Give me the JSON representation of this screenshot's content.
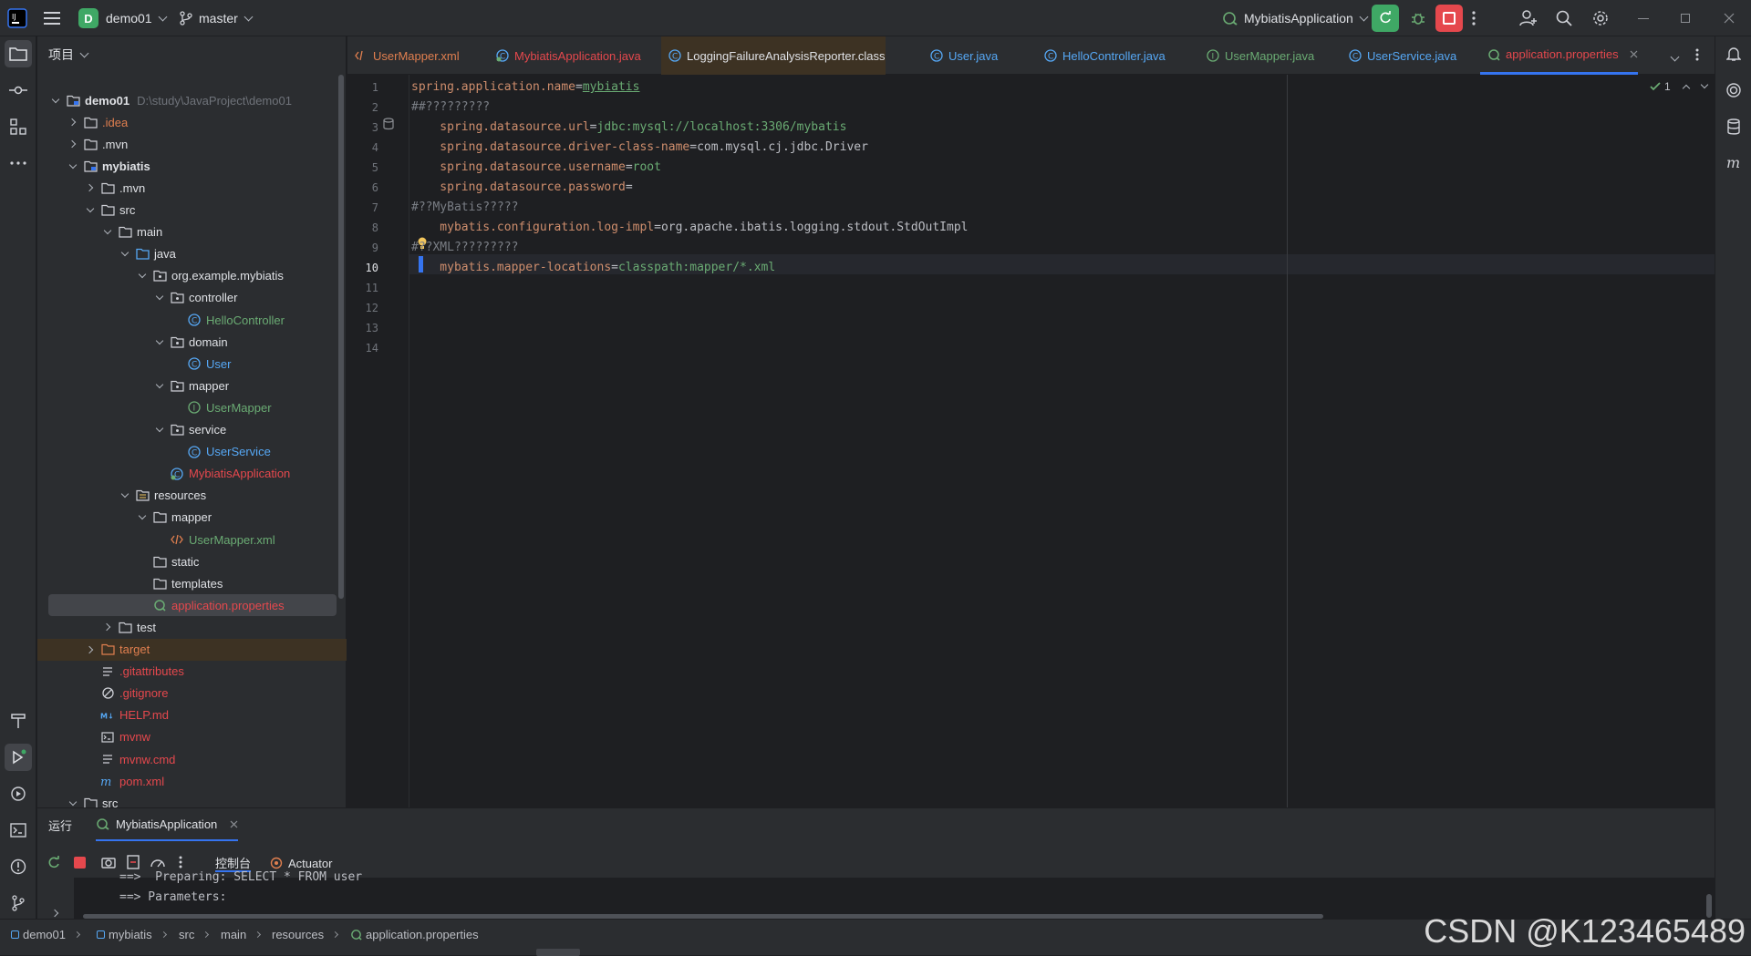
{
  "titlebar": {
    "project_letter": "D",
    "project_name": "demo01",
    "branch": "master",
    "run_config": "MybiatisApplication"
  },
  "project_panel": {
    "title": "项目",
    "tree": [
      {
        "label": "demo01",
        "path": "D:\\study\\JavaProject\\demo01"
      },
      {
        "label": ".idea"
      },
      {
        "label": ".mvn"
      },
      {
        "label": "mybiatis"
      },
      {
        "label": ".mvn"
      },
      {
        "label": "src"
      },
      {
        "label": "main"
      },
      {
        "label": "java"
      },
      {
        "label": "org.example.mybiatis"
      },
      {
        "label": "controller"
      },
      {
        "label": "HelloController"
      },
      {
        "label": "domain"
      },
      {
        "label": "User"
      },
      {
        "label": "mapper"
      },
      {
        "label": "UserMapper"
      },
      {
        "label": "service"
      },
      {
        "label": "UserService"
      },
      {
        "label": "MybiatisApplication"
      },
      {
        "label": "resources"
      },
      {
        "label": "mapper"
      },
      {
        "label": "UserMapper.xml"
      },
      {
        "label": "static"
      },
      {
        "label": "templates"
      },
      {
        "label": "application.properties"
      },
      {
        "label": "test"
      },
      {
        "label": "target"
      },
      {
        "label": ".gitattributes"
      },
      {
        "label": ".gitignore"
      },
      {
        "label": "HELP.md"
      },
      {
        "label": "mvnw"
      },
      {
        "label": "mvnw.cmd"
      },
      {
        "label": "pom.xml"
      },
      {
        "label": "src"
      }
    ]
  },
  "tabs": [
    {
      "label": "UserMapper.xml"
    },
    {
      "label": "MybiatisApplication.java"
    },
    {
      "label": "LoggingFailureAnalysisReporter.class"
    },
    {
      "label": "User.java"
    },
    {
      "label": "HelloController.java"
    },
    {
      "label": "UserMapper.java"
    },
    {
      "label": "UserService.java"
    },
    {
      "label": "application.properties"
    }
  ],
  "editor": {
    "inspection_count": "1",
    "lines": [
      {
        "n": "1",
        "key": "spring.application.name",
        "val": "mybiatis"
      },
      {
        "n": "2",
        "comment": "##?????????"
      },
      {
        "n": "3",
        "key": "    spring.datasource.url",
        "val": "jdbc:mysql://localhost:3306/mybatis"
      },
      {
        "n": "4",
        "key": "    spring.datasource.driver-class-name",
        "plain": "com.mysql.cj.jdbc.Driver"
      },
      {
        "n": "5",
        "key": "    spring.datasource.username",
        "val": "root"
      },
      {
        "n": "6",
        "key": "    spring.datasource.password",
        "val": ""
      },
      {
        "n": "7",
        "comment": "#??MyBatis?????"
      },
      {
        "n": "8",
        "key": "    mybatis.configuration.log-impl",
        "plain": "org.apache.ibatis.logging.stdout.StdOutImpl"
      },
      {
        "n": "9",
        "comment": "#??XML?????????"
      },
      {
        "n": "10",
        "key": "    mybatis.mapper-locations",
        "val": "classpath:mapper/*.xml"
      },
      {
        "n": "11"
      },
      {
        "n": "12"
      },
      {
        "n": "13"
      },
      {
        "n": "14"
      }
    ]
  },
  "run_panel": {
    "title": "运行",
    "config_tab": "MybiatisApplication",
    "console_tab": "控制台",
    "actuator_tab": "Actuator",
    "console_lines": [
      "==>  Preparing: SELECT * FROM user",
      "==> Parameters: "
    ]
  },
  "statusbar": {
    "breadcrumbs": [
      "demo01",
      "mybiatis",
      "src",
      "main",
      "resources",
      "application.properties"
    ],
    "watermark": "CSDN @K123465489"
  },
  "colors": {
    "accent": "#3574f0",
    "run_green": "#3fa865",
    "stop_red": "#e5484d",
    "key_orange": "#cf8e6d",
    "value_green": "#6aab73"
  }
}
